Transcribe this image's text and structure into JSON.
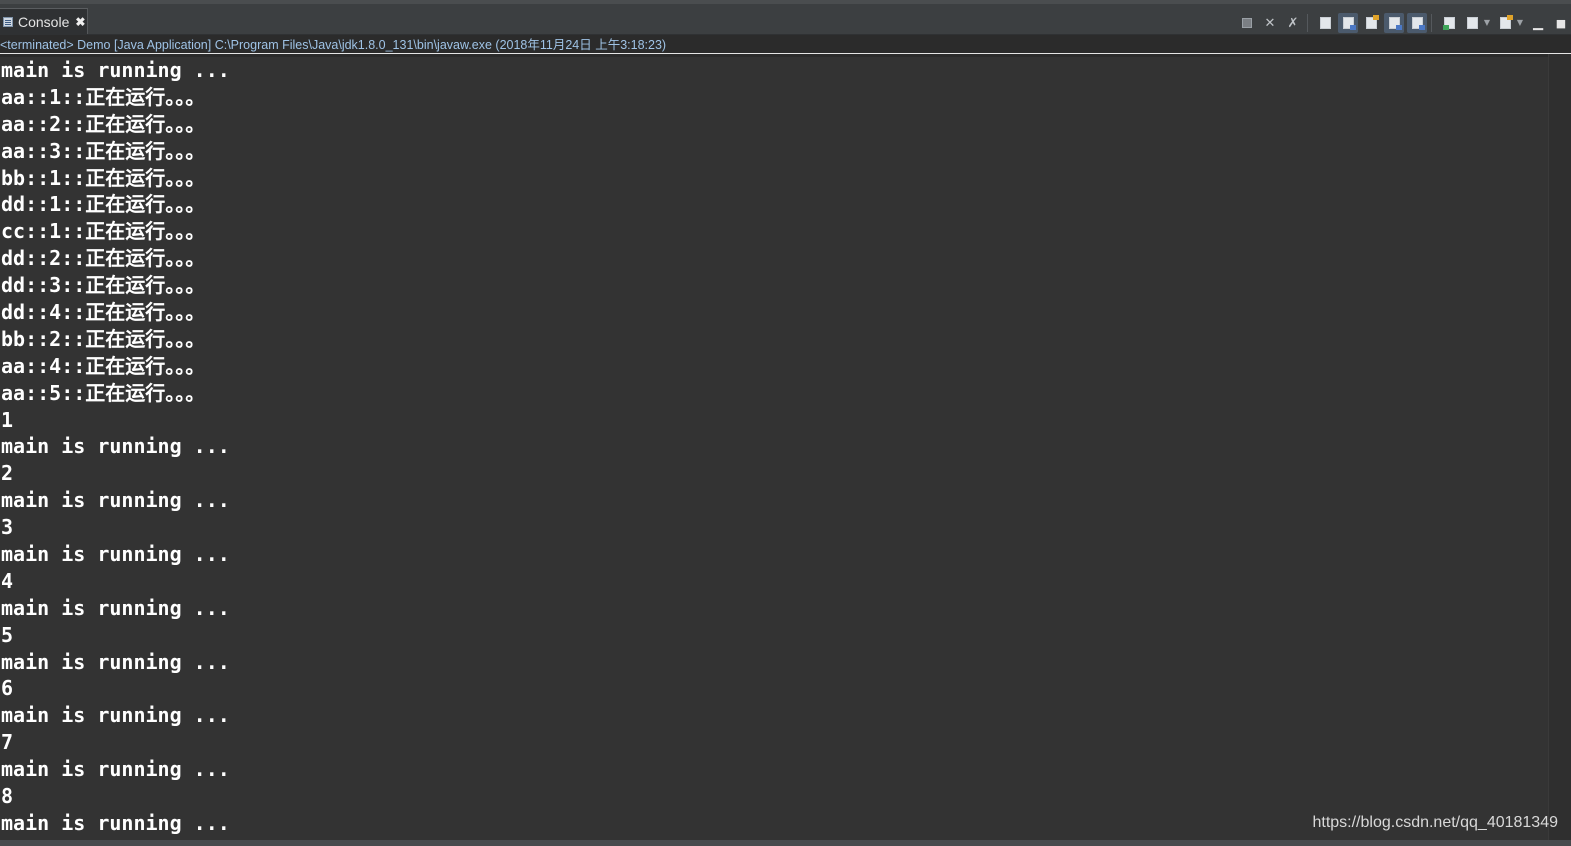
{
  "tab": {
    "label": "Console",
    "close": "✖"
  },
  "toolbar": {
    "buttons": [
      {
        "name": "terminate",
        "icon": "stop-icon"
      },
      {
        "name": "remove-launch",
        "icon": "remove-icon"
      },
      {
        "name": "remove-all-terminated",
        "icon": "remove-all-icon"
      },
      {
        "name": "clear-console",
        "icon": "clear-console-icon"
      },
      {
        "name": "scroll-lock",
        "icon": "scroll-lock-icon"
      },
      {
        "name": "word-wrap",
        "icon": "word-wrap-icon"
      },
      {
        "name": "show-on-stdout",
        "icon": "show-stdout-icon"
      },
      {
        "name": "show-on-stderr",
        "icon": "show-stderr-icon"
      },
      {
        "name": "pin-console",
        "icon": "pin-icon"
      },
      {
        "name": "display-selected-console",
        "icon": "display-console-icon"
      },
      {
        "name": "open-console",
        "icon": "open-console-icon"
      },
      {
        "name": "minimize",
        "icon": "minimize-icon"
      },
      {
        "name": "maximize",
        "icon": "maximize-icon"
      }
    ]
  },
  "status_line": "<terminated> Demo [Java Application] C:\\Program Files\\Java\\jdk1.8.0_131\\bin\\javaw.exe (2018年11月24日 上午3:18:23)",
  "console_lines": [
    "main is running ...",
    "aa::1::正在运行。。。",
    "aa::2::正在运行。。。",
    "aa::3::正在运行。。。",
    "bb::1::正在运行。。。",
    "dd::1::正在运行。。。",
    "cc::1::正在运行。。。",
    "dd::2::正在运行。。。",
    "dd::3::正在运行。。。",
    "dd::4::正在运行。。。",
    "bb::2::正在运行。。。",
    "aa::4::正在运行。。。",
    "aa::5::正在运行。。。",
    "1",
    "main is running ...",
    "2",
    "main is running ...",
    "3",
    "main is running ...",
    "4",
    "main is running ...",
    "5",
    "main is running ...",
    "6",
    "main is running ...",
    "7",
    "main is running ...",
    "8",
    "main is running ..."
  ],
  "watermark": "https://blog.csdn.net/qq_40181349",
  "colors": {
    "console_bg": "#333333",
    "console_text": "#ffffff",
    "status_text": "#9fc3e6",
    "tabbar_bg": "#3c3f41"
  }
}
